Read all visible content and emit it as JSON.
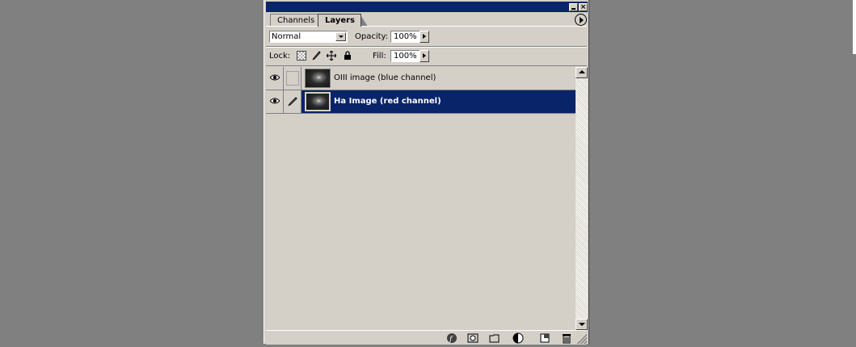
{
  "panel": {
    "tabs": [
      {
        "label": "Channels",
        "active": false
      },
      {
        "label": "Layers",
        "active": true
      }
    ],
    "blend_mode": {
      "selected": "Normal"
    },
    "opacity": {
      "label": "Opacity:",
      "value": "100%"
    },
    "lock": {
      "label": "Lock:",
      "icons": [
        "lock-transparency-icon",
        "lock-image-icon",
        "lock-position-icon",
        "lock-all-icon"
      ]
    },
    "fill": {
      "label": "Fill:",
      "value": "100%"
    },
    "layers": [
      {
        "name": "OIII image (blue channel)",
        "visible": true,
        "selected": false
      },
      {
        "name": "Ha Image (red channel)",
        "visible": true,
        "selected": true
      }
    ],
    "footer_icons": [
      "layer-styles-icon",
      "layer-mask-icon",
      "new-group-icon",
      "adjustment-layer-icon",
      "new-layer-icon",
      "trash-icon"
    ]
  },
  "colors": {
    "title_bar": "#0a246a",
    "selection": "#0a246a",
    "panel_bg": "#d4d0c8",
    "desktop_bg": "#808080"
  }
}
